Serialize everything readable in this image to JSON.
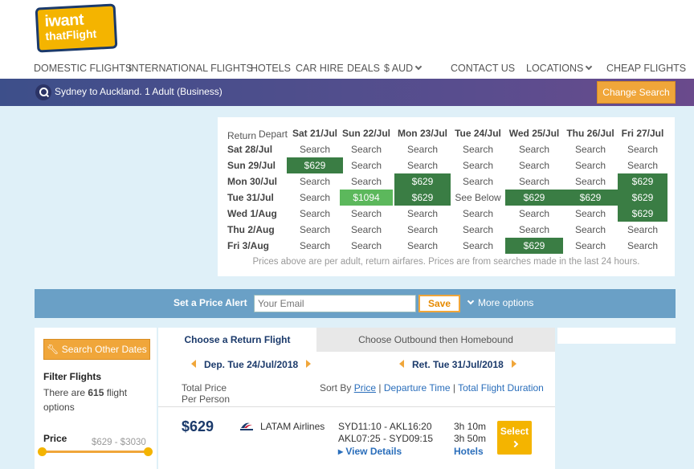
{
  "brand": {
    "logo_line1": "iwant",
    "logo_line2": "thatFlight"
  },
  "nav": {
    "domestic": "DOMESTIC FLIGHTS",
    "international": "INTERNATIONAL FLIGHTS",
    "hotels": "HOTELS",
    "car_hire": "CAR HIRE",
    "deals": "DEALS",
    "currency": "$ AUD",
    "contact": "CONTACT US",
    "locations": "LOCATIONS",
    "cheap": "CHEAP FLIGHTS"
  },
  "search_summary": "Sydney to Auckland. 1 Adult (Business)",
  "change_search": "Change Search",
  "matrix": {
    "return_label": "Return",
    "depart_label": "Depart",
    "columns": [
      "Sat 21/Jul",
      "Sun 22/Jul",
      "Mon 23/Jul",
      "Tue 24/Jul",
      "Wed 25/Jul",
      "Thu 26/Jul",
      "Fri 27/Jul"
    ],
    "rows": [
      {
        "label": "Sat 28/Jul",
        "cells": [
          "Search",
          "Search",
          "Search",
          "Search",
          "Search",
          "Search",
          "Search"
        ]
      },
      {
        "label": "Sun 29/Jul",
        "cells": [
          "$629",
          "Search",
          "Search",
          "Search",
          "Search",
          "Search",
          "Search"
        ]
      },
      {
        "label": "Mon 30/Jul",
        "cells": [
          "Search",
          "Search",
          "$629",
          "Search",
          "Search",
          "Search",
          "$629"
        ]
      },
      {
        "label": "Tue 31/Jul",
        "cells": [
          "Search",
          "$1094",
          "$629",
          "See Below",
          "$629",
          "$629",
          "$629"
        ]
      },
      {
        "label": "Wed 1/Aug",
        "cells": [
          "Search",
          "Search",
          "Search",
          "Search",
          "Search",
          "Search",
          "$629"
        ]
      },
      {
        "label": "Thu 2/Aug",
        "cells": [
          "Search",
          "Search",
          "Search",
          "Search",
          "Search",
          "Search",
          "Search"
        ]
      },
      {
        "label": "Fri 3/Aug",
        "cells": [
          "Search",
          "Search",
          "Search",
          "Search",
          "$629",
          "Search",
          "Search"
        ]
      }
    ],
    "note": "Prices above are per adult, return airfares. Prices are from searches made in the last 24 hours."
  },
  "price_alert": {
    "label": "Set a Price Alert",
    "email_placeholder": "Your Email",
    "save": "Save",
    "more_options": "More options"
  },
  "filters": {
    "search_other_dates": "Search Other Dates",
    "title": "Filter Flights",
    "count_prefix": "There are ",
    "count": "615",
    "count_suffix": " flight options",
    "price_title": "Price",
    "price_range": "$629 - $3030"
  },
  "results": {
    "tab_return": "Choose a Return Flight",
    "tab_outbound": "Choose Outbound then Homebound",
    "dep_date": "Dep. Tue 24/Jul/2018",
    "ret_date": "Ret. Tue 31/Jul/2018",
    "total_price_line1": "Total Price",
    "total_price_line2": "Per Person",
    "sort_by": "Sort By",
    "sort_price": "Price",
    "sort_departure": "Departure Time",
    "sort_duration": "Total Flight Duration",
    "flight": {
      "price": "$629",
      "airline": "LATAM Airlines",
      "outbound": "SYD11:10 - AKL16:20",
      "inbound": "AKL07:25 - SYD09:15",
      "outbound_duration": "3h 10m",
      "inbound_duration": "3h 50m",
      "view_details": "View Details",
      "hotels": "Hotels",
      "select": "Select"
    }
  },
  "colors": {
    "accent": "#f0a63a",
    "navy": "#1b3a6b",
    "green": "#3a7d44",
    "light_green": "#5cb85c",
    "bar_blue": "#6aa0c6"
  }
}
